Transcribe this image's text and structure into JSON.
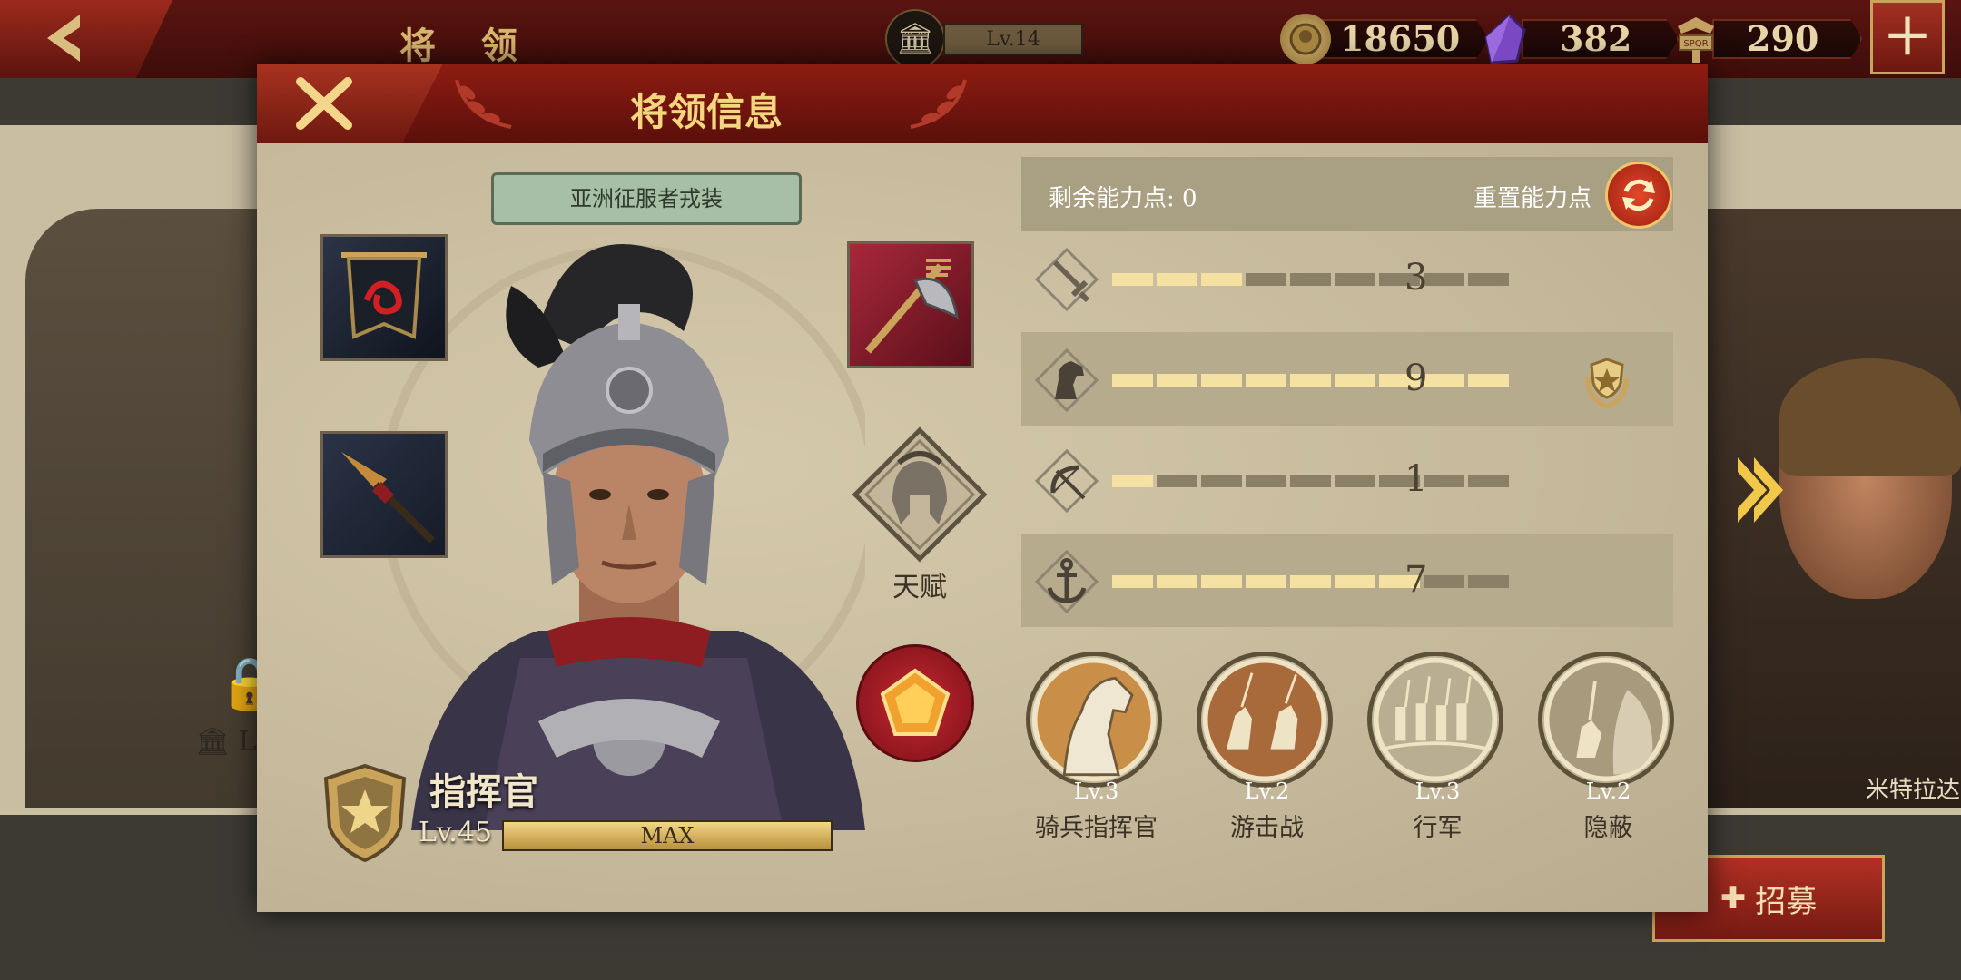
{
  "topbar": {
    "title": "将 领",
    "hall_level": "Lv.14",
    "resources": [
      {
        "name": "coin",
        "value": "18650",
        "icon": "coin-icon",
        "color": "#b99a5a"
      },
      {
        "name": "gem",
        "value": "382",
        "icon": "purple-gem-icon",
        "color": "#6b3aa8"
      },
      {
        "name": "token",
        "value": "290",
        "icon": "spqr-eagle-icon",
        "color": "#b99a5a"
      }
    ],
    "plus_label": "+"
  },
  "background": {
    "left_level": "Lv",
    "right_name": "米特拉达",
    "recruit_label": "招募"
  },
  "modal": {
    "title": "将领信息",
    "outfit": "亚洲征服者戎装",
    "talent_label": "天赋",
    "rank": "指挥官",
    "level": "Lv.45",
    "exp_label": "MAX",
    "exp_fraction": 1.0,
    "points_label": "剩余能力点: 0",
    "reset_label": "重置能力点",
    "stats": [
      {
        "icon": "sword-icon",
        "value": "3",
        "max": 9
      },
      {
        "icon": "horse-icon",
        "value": "9",
        "max": 9,
        "medal": "laurel-star-medal-icon"
      },
      {
        "icon": "bow-icon",
        "value": "1",
        "max": 9
      },
      {
        "icon": "anchor-icon",
        "value": "7",
        "max": 9
      }
    ],
    "skills": [
      {
        "level": "Lv.3",
        "name": "骑兵指挥官",
        "icon": "horse-head-skill-icon"
      },
      {
        "level": "Lv.2",
        "name": "游击战",
        "icon": "cavalry-skill-icon"
      },
      {
        "level": "Lv.3",
        "name": "行军",
        "icon": "march-skill-icon"
      },
      {
        "level": "Lv.2",
        "name": "隐蔽",
        "icon": "ambush-skill-icon"
      }
    ]
  },
  "colors": {
    "header_red": "#8e1c12",
    "gold": "#c9a45a",
    "title_gold": "#f4d67e",
    "bar_on": "#f5e2a3",
    "bar_off": "#8a8067"
  }
}
